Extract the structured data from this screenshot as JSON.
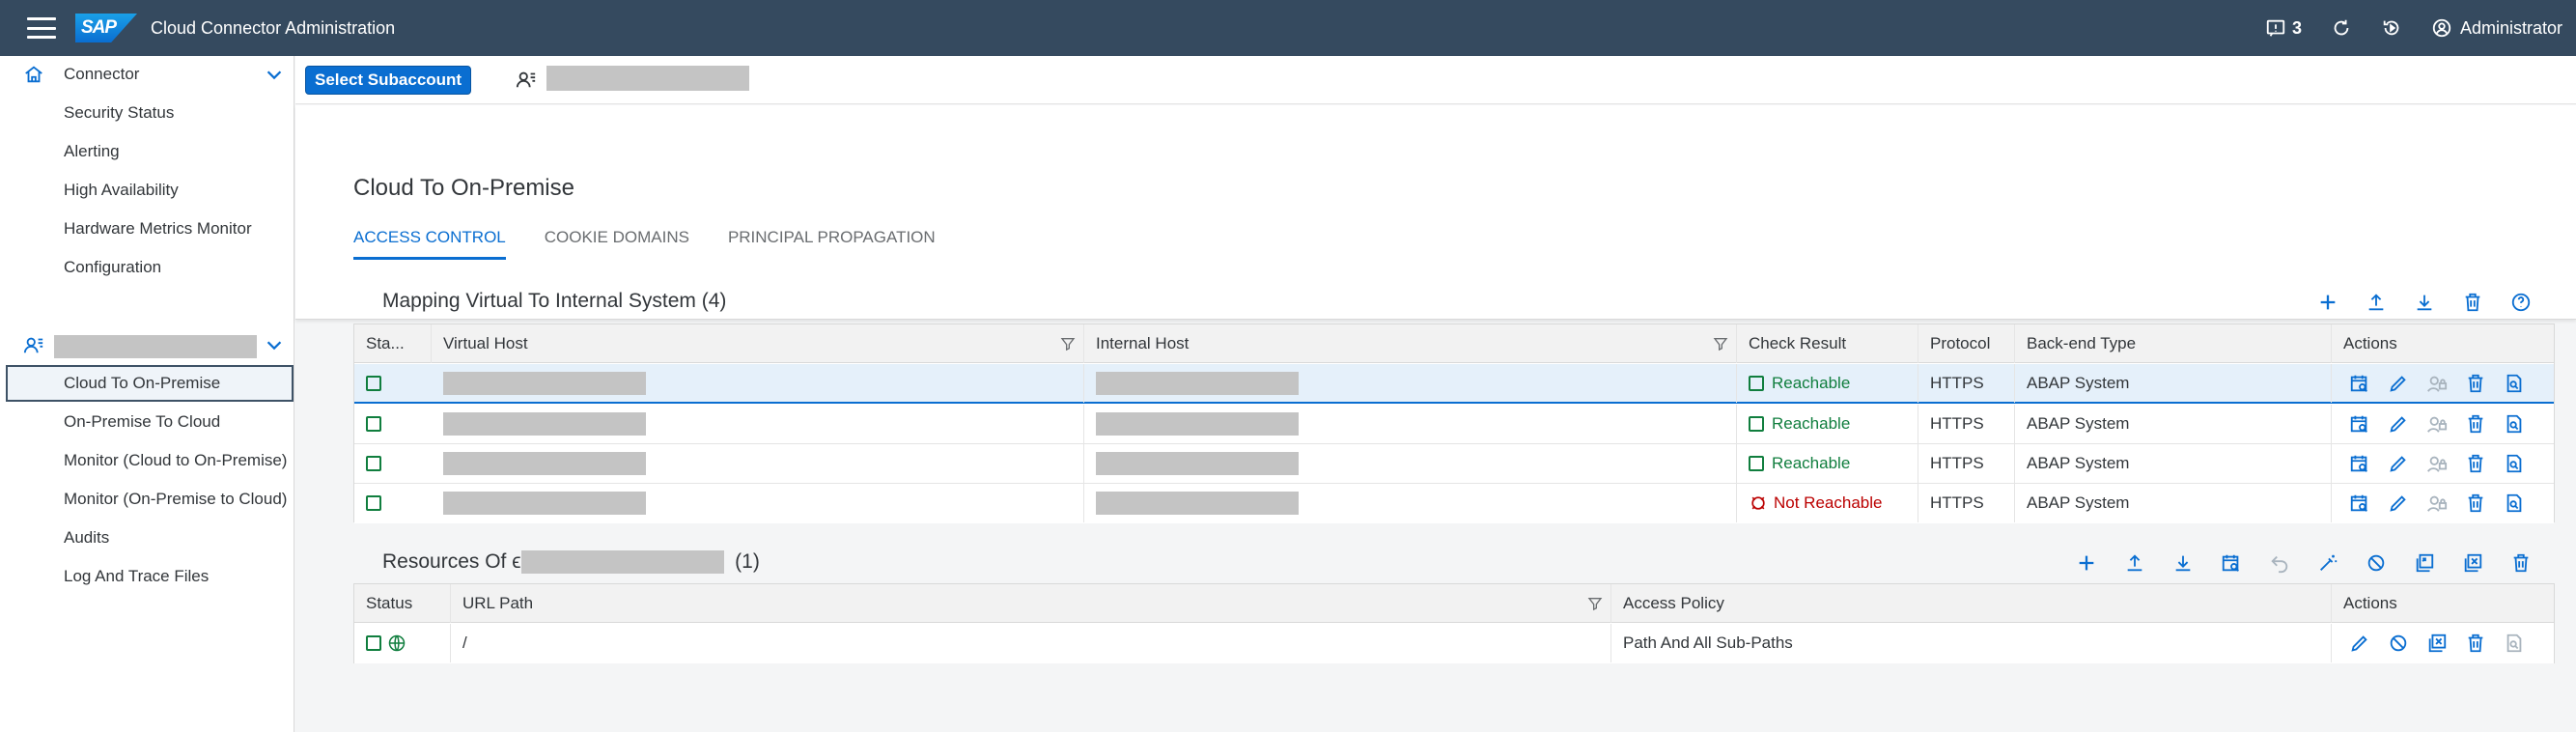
{
  "shell": {
    "logo_text": "SAP",
    "title": "Cloud Connector Administration",
    "notifications_count": "3",
    "user_label": "Administrator"
  },
  "sidebar": {
    "connector_label": "Connector",
    "connector_items": [
      "Security Status",
      "Alerting",
      "High Availability",
      "Hardware Metrics Monitor",
      "Configuration"
    ],
    "subaccount_items": [
      "Cloud To On-Premise",
      "On-Premise To Cloud",
      "Monitor (Cloud to On-Premise)",
      "Monitor (On-Premise to Cloud)",
      "Audits",
      "Log And Trace Files"
    ]
  },
  "subbar": {
    "select_label": "Select Subaccount"
  },
  "page": {
    "title": "Cloud To On-Premise",
    "tabs": [
      "ACCESS CONTROL",
      "COOKIE DOMAINS",
      "PRINCIPAL PROPAGATION"
    ]
  },
  "mapping": {
    "title": "Mapping Virtual To Internal System",
    "count": "(4)",
    "columns": [
      "Sta...",
      "Virtual Host",
      "Internal Host",
      "Check Result",
      "Protocol",
      "Back-end Type",
      "Actions"
    ],
    "rows": [
      {
        "check": "Reachable",
        "protocol": "HTTPS",
        "backend": "ABAP System"
      },
      {
        "check": "Reachable",
        "protocol": "HTTPS",
        "backend": "ABAP System"
      },
      {
        "check": "Reachable",
        "protocol": "HTTPS",
        "backend": "ABAP System"
      },
      {
        "check": "Not Reachable",
        "protocol": "HTTPS",
        "backend": "ABAP System"
      }
    ]
  },
  "resources": {
    "title_prefix": "Resources Of ϵ",
    "count": "(1)",
    "columns": [
      "Status",
      "URL Path",
      "Access Policy",
      "Actions"
    ],
    "rows": [
      {
        "url": "/",
        "policy": "Path And All Sub-Paths"
      }
    ]
  },
  "colors": {
    "shell": "#354a5f",
    "accent": "#0a6ed1",
    "success": "#107e3e",
    "error": "#bb0000"
  }
}
